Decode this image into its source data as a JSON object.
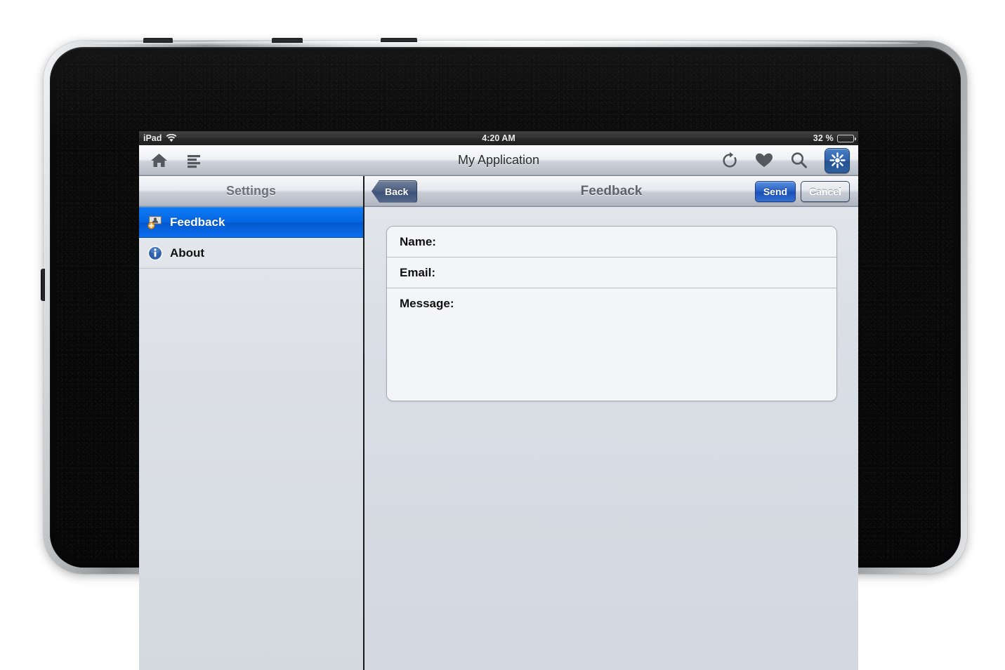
{
  "device": {
    "name": "iPad",
    "orientation": "landscape"
  },
  "status_bar": {
    "carrier_label": "iPad",
    "wifi_icon": "wifi-icon",
    "time": "4:20 AM",
    "battery_percent": "32 %",
    "battery_level": 32,
    "battery_icon": "battery-icon"
  },
  "toolbar": {
    "title": "My Application",
    "left_icons": [
      {
        "name": "home-icon",
        "label": "Home"
      },
      {
        "name": "list-icon",
        "label": "List"
      }
    ],
    "right_icons": [
      {
        "name": "refresh-icon",
        "label": "Refresh"
      },
      {
        "name": "heart-icon",
        "label": "Favorites"
      },
      {
        "name": "search-icon",
        "label": "Search"
      }
    ],
    "accent_button": {
      "name": "starburst-button",
      "icon": "starburst-icon",
      "color": "#2f63ad"
    }
  },
  "sidebar": {
    "header": "Settings",
    "items": [
      {
        "label": "Feedback",
        "icon": "comment-add-icon",
        "selected": true
      },
      {
        "label": "About",
        "icon": "info-icon",
        "selected": false
      }
    ],
    "selected_color": "#0565e2"
  },
  "detail": {
    "back_label": "Back",
    "title": "Feedback",
    "actions": [
      {
        "label": "Send",
        "name": "send-button",
        "color": "#2a64c8"
      },
      {
        "label": "Cancel",
        "name": "cancel-button",
        "color": "#56688a"
      }
    ],
    "form": {
      "rows": [
        {
          "label": "Name:",
          "value": "",
          "placeholder": ""
        },
        {
          "label": "Email:",
          "value": "",
          "placeholder": ""
        },
        {
          "label": "Message:",
          "value": "",
          "placeholder": ""
        }
      ]
    }
  }
}
